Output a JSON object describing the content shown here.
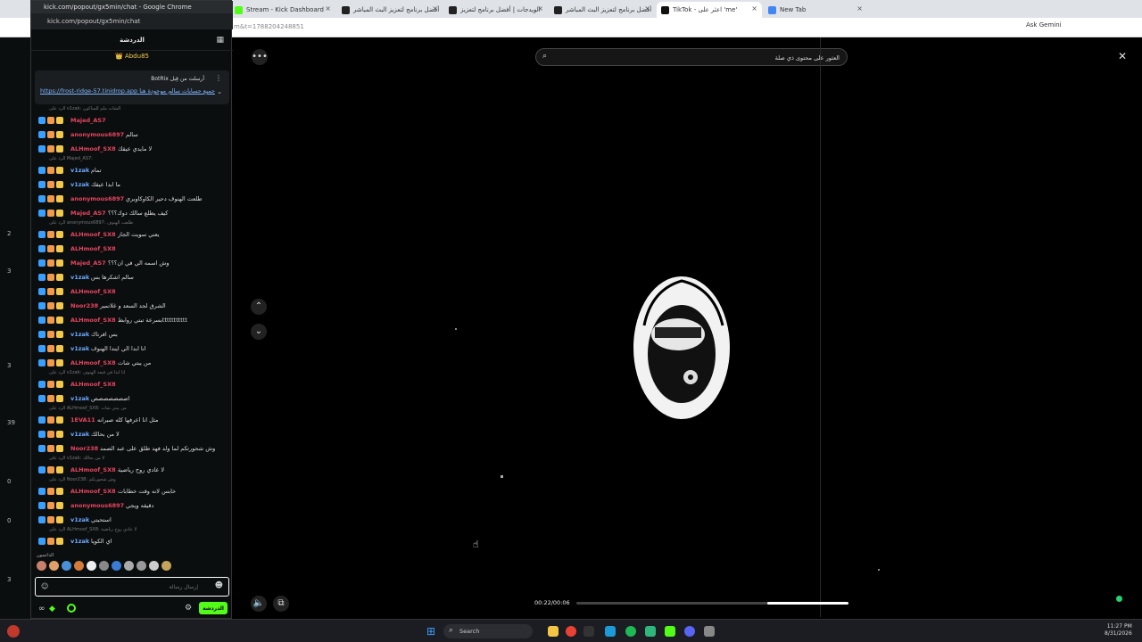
{
  "browser": {
    "tabs": [
      {
        "label": "Stream - Kick Dashboard",
        "color": "#53fc18"
      },
      {
        "label": "أفضل برنامج لتعزيز البث المباشر",
        "color": "#222"
      },
      {
        "label": "الويدجات | أفضل برنامج لتعزيز",
        "color": "#222"
      },
      {
        "label": "أفضل برنامج لتعزيز البث المباشر",
        "color": "#222"
      },
      {
        "label": "TikTok - اعثر على 'me'",
        "color": "#111"
      },
      {
        "label": "New Tab",
        "color": "#4285f4"
      }
    ],
    "url_tail": "m&t=1788204248851",
    "ask_gemini": "Ask Gemini"
  },
  "popup": {
    "window_title": "kick.com/popout/gx5min/chat - Google Chrome",
    "url": "kick.com/popout/gx5min/chat",
    "chat_title": "الدردشة",
    "pinned_user": "Abdu85",
    "pinned": {
      "header": "BotRix أرسلت من قِبل",
      "link": "https://frost-ridge-57.tinidrop.app جميع حسابات سالم موجودة هنا"
    },
    "messages": [
      {
        "reply": "الرد على v1zak: الشات ملم للساكون"
      },
      {
        "user": "Majed_AS7",
        "color": "#e8455f",
        "text": ""
      },
      {
        "user": "anonymous6897",
        "color": "#e8455f",
        "text": "سالم"
      },
      {
        "user": "ALHmoof_SX8",
        "color": "#e8455f",
        "text": "لا مايدي عيقك"
      },
      {
        "reply": "الرد على Majed_AS7:"
      },
      {
        "user": "v1zak",
        "color": "#6aa8ff",
        "text": "تمام"
      },
      {
        "user": "v1zak",
        "color": "#6aa8ff",
        "text": "ما ابدا عيقك"
      },
      {
        "user": "anonymous6897",
        "color": "#e8455f",
        "text": "طلعت الهنوف دحير الكاوكاوبري"
      },
      {
        "user": "Majed_AS7",
        "color": "#e8455f",
        "text": "كيف يطلع سالك دوك؟؟؟"
      },
      {
        "reply": "الرد على anonymous6897: طلعت الهنوف"
      },
      {
        "user": "ALHmoof_SX8",
        "color": "#e8455f",
        "text": "يعني سويت الجاز"
      },
      {
        "user": "ALHmoof_SX8",
        "color": "#e8455f",
        "text": ""
      },
      {
        "user": "Majed_AS7",
        "color": "#e8455f",
        "text": "وش اسمه الي في ان؟؟؟"
      },
      {
        "user": "v1zak",
        "color": "#6aa8ff",
        "text": "سالم اشكرها بس"
      },
      {
        "user": "ALHmoof_SX8",
        "color": "#e8455f",
        "text": ""
      },
      {
        "user": "Noor238",
        "color": "#e8455f",
        "text": "الشرق لجد السعد و غلاتمير"
      },
      {
        "user": "ALHmoof_SX8",
        "color": "#e8455f",
        "text": "بسرعة تبتي روابطttttttttttt"
      },
      {
        "user": "v1zak",
        "color": "#6aa8ff",
        "text": "بس افرناك"
      },
      {
        "user": "v1zak",
        "color": "#6aa8ff",
        "text": "انا ابدا الي ايندا الهنوف"
      },
      {
        "user": "ALHmoof_SX8",
        "color": "#e8455f",
        "text": "من يبتي شات"
      },
      {
        "reply": "الرد على v1zak: انا ابدا في قيعة الهنوف"
      },
      {
        "user": "ALHmoof_SX8",
        "color": "#e8455f",
        "text": ""
      },
      {
        "user": "v1zak",
        "color": "#6aa8ff",
        "text": "اصصصصصصص"
      },
      {
        "reply": "الرد على ALHmoof_SX8: من يبتي شات"
      },
      {
        "user": "1EVA11",
        "color": "#e8455f",
        "text": "مثل انا اعرفها كله صبرانه"
      },
      {
        "user": "v1zak",
        "color": "#6aa8ff",
        "text": "لا من بحالك"
      },
      {
        "user": "Noor238",
        "color": "#e8455f",
        "text": "وش شحورتكم لما ولد فهد طلق على عبد الصمد"
      },
      {
        "reply": "الرد على v1zak: لا من بحالك"
      },
      {
        "user": "ALHmoof_SX8",
        "color": "#e8455f",
        "text": "لا عادي روح رياضية"
      },
      {
        "reply": "الرد على Noor238: وش شحورتكم"
      },
      {
        "user": "ALHmoof_SX8",
        "color": "#e8455f",
        "text": "خابس لانه وقت خطابات"
      },
      {
        "user": "anonymous6897",
        "color": "#e8455f",
        "text": "دقيقه ويجي"
      },
      {
        "user": "v1zak",
        "color": "#6aa8ff",
        "text": "استحيتي"
      },
      {
        "reply": "الرد على ALHmoof_SX8: لا عادي روح رياضية"
      },
      {
        "user": "v1zak",
        "color": "#6aa8ff",
        "text": "اي الكويا"
      }
    ],
    "supporters_label": "الداعمون",
    "input_placeholder": "إرسال رسالة",
    "send_label": "الدردشة"
  },
  "sidebar_counts": [
    "2",
    "3",
    "3",
    "39",
    "0",
    "0",
    "3"
  ],
  "tiktok": {
    "search_placeholder": "العثور على محتوى ذي صلة",
    "time": "00:22/00:06",
    "progress_fraction": 0.3
  },
  "taskbar": {
    "search_label": "Search",
    "time": "11:27 PM",
    "date": "8/31/2026"
  }
}
